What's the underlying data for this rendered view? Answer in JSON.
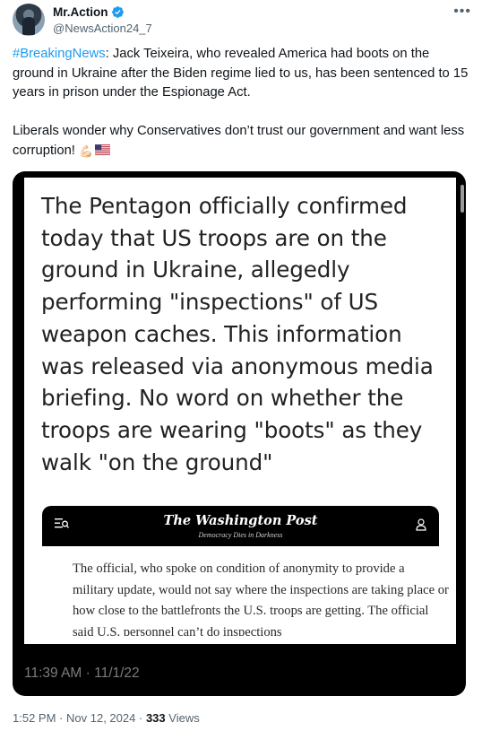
{
  "author": {
    "display_name": "Mr.Action",
    "handle": "@NewsAction24_7",
    "verified": true,
    "avatar_icon": "profile-photo"
  },
  "menu_icon": "more-horizontal-icon",
  "tweet": {
    "hashtag": "#BreakingNews",
    "body_1": ": Jack Teixeira, who revealed America had boots on the ground in Ukraine after the Biden regime lied to us, has been sentenced to 15 years in prison under the Espionage Act.",
    "body_2": "Liberals wonder why Conservatives don’t trust our government and want less corruption!",
    "emoji_1": "💪🏻",
    "emoji_2": "🇺🇸"
  },
  "media": {
    "headline": "The Pentagon officially confirmed today that US troops are on the ground in Ukraine, allegedly performing \"inspections\" of US weapon caches. This information was released via anonymous media briefing. No word on whether the troops are wearing \"boots\" as they walk \"on the ground\"",
    "newspaper": {
      "title": "The Washington Post",
      "tagline": "Democracy Dies in Darkness"
    },
    "article_excerpt": "The official, who spoke on condition of anonymity to provide a military update, would not say where the inspections are taking place or how close to the battlefronts the U.S. troops are getting. The official said U.S. personnel can’t do inspections",
    "timestamp": "11:39 AM · 11/1/22"
  },
  "footer": {
    "time": "1:52 PM",
    "date": "Nov 12, 2024",
    "separator": "·",
    "views_count": "333",
    "views_label": "Views"
  },
  "colors": {
    "accent": "#1d9bf0",
    "text": "#0f1419",
    "muted": "#536471"
  }
}
